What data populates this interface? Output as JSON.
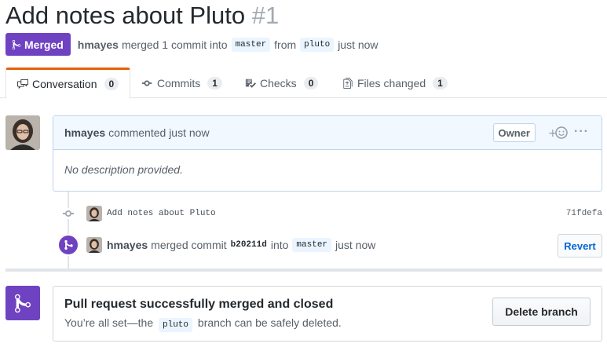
{
  "pr": {
    "title": "Add notes about Pluto",
    "number": "#1",
    "state_badge": "Merged",
    "author": "hmayes",
    "merge_summary": "merged 1 commit into",
    "base_branch": "master",
    "from_text": "from",
    "head_branch": "pluto",
    "time": "just now"
  },
  "tabs": [
    {
      "label": "Conversation",
      "count": "0"
    },
    {
      "label": "Commits",
      "count": "1"
    },
    {
      "label": "Checks",
      "count": "0"
    },
    {
      "label": "Files changed",
      "count": "1"
    }
  ],
  "comment": {
    "author": "hmayes",
    "action": "commented just now",
    "role": "Owner",
    "body": "No description provided."
  },
  "commit": {
    "message": "Add notes about Pluto",
    "sha": "71fdefa"
  },
  "merge_event": {
    "author": "hmayes",
    "text1": "merged commit",
    "sha": "b20211d",
    "text2": "into",
    "branch": "master",
    "time": "just now",
    "revert_label": "Revert"
  },
  "merged_box": {
    "title": "Pull request successfully merged and closed",
    "sub_before": "You’re all set—the",
    "branch": "pluto",
    "sub_after": "branch can be safely deleted.",
    "delete_label": "Delete branch"
  },
  "colors": {
    "merged_purple": "#6f42c1",
    "link_blue": "#0366d6",
    "tab_accent": "#e36209"
  }
}
